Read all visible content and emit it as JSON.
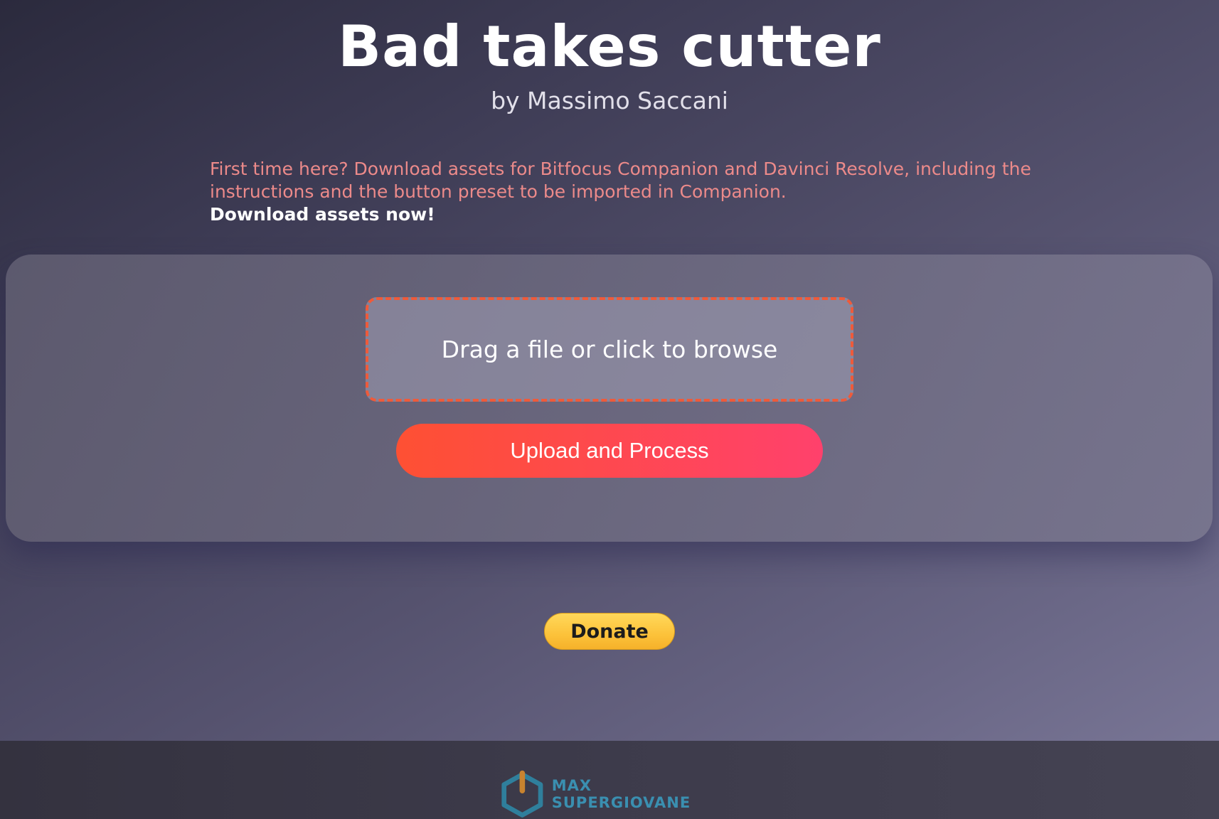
{
  "header": {
    "title": "Bad takes cutter",
    "subtitle": "by Massimo Saccani"
  },
  "notice": {
    "text": "First time here? Download assets for Bitfocus Companion and Davinci Resolve, including the instructions and the button preset to be imported in Companion.",
    "link_label": "Download assets now!"
  },
  "upload": {
    "dropzone_label": "Drag a file or click to browse",
    "button_label": "Upload and Process"
  },
  "donate": {
    "label": "Donate"
  },
  "footer": {
    "brand_text": "MAX SUPERGIOVANE",
    "logo_icon": "power-hexagon-icon"
  },
  "colors": {
    "accent_start": "#fe5033",
    "accent_end": "#ff416c",
    "notice_text": "#ec8a8a",
    "dropzone_border": "#ef5a3a",
    "donate_yellow": "#fcc23a",
    "brand_blue": "#3a8fb0",
    "brand_orange": "#c8832f"
  }
}
